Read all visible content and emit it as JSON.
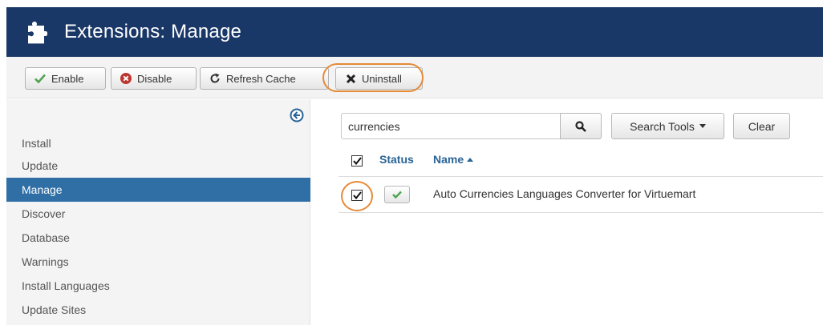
{
  "header": {
    "title": "Extensions: Manage",
    "icon": "puzzle-icon",
    "bg": "#1a3867"
  },
  "toolbar": {
    "enable_label": "Enable",
    "disable_label": "Disable",
    "refresh_label": "Refresh Cache",
    "uninstall_label": "Uninstall"
  },
  "sidebar": {
    "items": [
      {
        "label": "Install"
      },
      {
        "label": "Update"
      },
      {
        "label": "Manage",
        "active": true
      },
      {
        "label": "Discover"
      },
      {
        "label": "Database"
      },
      {
        "label": "Warnings"
      },
      {
        "label": "Install Languages"
      },
      {
        "label": "Update Sites"
      }
    ]
  },
  "filter": {
    "search_value": "currencies",
    "search_tools_label": "Search Tools",
    "clear_label": "Clear"
  },
  "table": {
    "headers": {
      "status": "Status",
      "name": "Name"
    },
    "rows": [
      {
        "checked": true,
        "status": "enabled",
        "name": "Auto Currencies Languages Converter for Virtuemart"
      }
    ]
  },
  "colors": {
    "accent": "#2f6fa6",
    "highlight": "#e58a37",
    "enabled_check": "#51a351"
  }
}
